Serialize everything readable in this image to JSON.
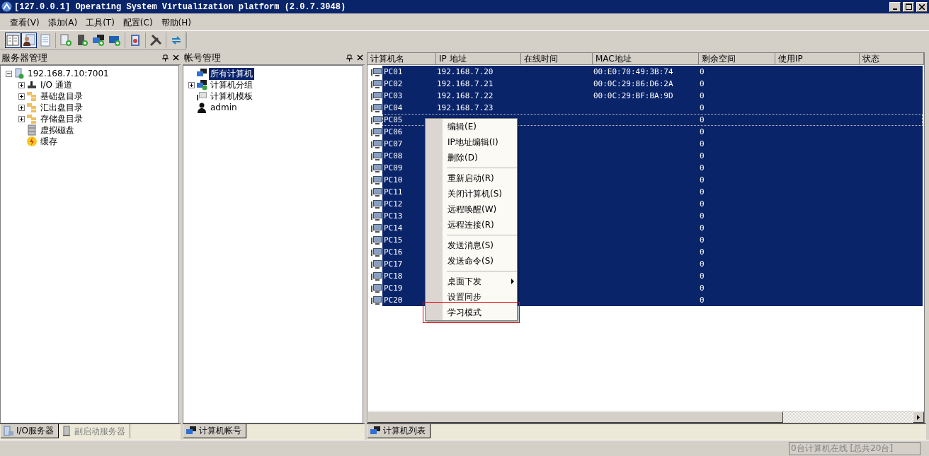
{
  "window": {
    "title": "[127.0.0.1] Operating System Virtualization platform (2.0.7.3048)"
  },
  "menu_bar": [
    "查看(V)",
    "添加(A)",
    "工具(T)",
    "配置(C)",
    "帮助(H)"
  ],
  "toolbar_groups": [
    [
      {
        "kind": "layout",
        "selected": true
      },
      {
        "kind": "user",
        "selected": true
      },
      {
        "kind": "document",
        "selected": false
      }
    ],
    [
      {
        "kind": "add-doc",
        "selected": false
      },
      {
        "kind": "add-server",
        "selected": false
      },
      {
        "kind": "add-network",
        "selected": false
      },
      {
        "kind": "add-monitor",
        "selected": false
      }
    ],
    [
      {
        "kind": "book",
        "selected": false
      }
    ],
    [
      {
        "kind": "tools",
        "selected": false
      }
    ],
    [
      {
        "kind": "sync",
        "selected": false
      }
    ]
  ],
  "server_panel": {
    "title": "服务器管理",
    "tree": [
      {
        "label": "192.168.7.10:7001",
        "kind": "server",
        "expanded": true,
        "children": [
          {
            "label": "I/O 通道",
            "kind": "channel",
            "expanded": false
          },
          {
            "label": "基础盘目录",
            "kind": "folders",
            "expanded": false
          },
          {
            "label": "汇出盘目录",
            "kind": "folders",
            "expanded": false
          },
          {
            "label": "存储盘目录",
            "kind": "folders",
            "expanded": false
          },
          {
            "label": "虚拟磁盘",
            "kind": "disk"
          },
          {
            "label": "缓存",
            "kind": "cache"
          }
        ]
      }
    ],
    "tabs": [
      {
        "label": "I/O服务器",
        "selected": true
      },
      {
        "label": "副启动服务器",
        "selected": false
      }
    ]
  },
  "account_panel": {
    "title": "帐号管理",
    "tree": [
      {
        "label": "所有计算机",
        "kind": "computers",
        "selected": true
      },
      {
        "label": "计算机分组",
        "kind": "group",
        "selected": false,
        "expanded": false
      },
      {
        "label": "计算机模板",
        "kind": "template",
        "selected": false
      },
      {
        "label": "admin",
        "kind": "user",
        "selected": false
      }
    ],
    "tabs": [
      {
        "label": "计算机帐号",
        "selected": true
      }
    ]
  },
  "computer_list": {
    "columns": [
      "计算机名",
      "IP 地址",
      "在线时间",
      "MAC地址",
      "剩余空间",
      "使用IP",
      "状态"
    ],
    "rows": [
      {
        "name": "PC01",
        "ip": "192.168.7.20",
        "mac": "00:E0:70:49:3B:74",
        "free": "0",
        "selected": true,
        "focused": false
      },
      {
        "name": "PC02",
        "ip": "192.168.7.21",
        "mac": "00:0C:29:86:D6:2A",
        "free": "0",
        "selected": true,
        "focused": false
      },
      {
        "name": "PC03",
        "ip": "192.168.7.22",
        "mac": "00:0C:29:BF:BA:9D",
        "free": "0",
        "selected": true,
        "focused": false
      },
      {
        "name": "PC04",
        "ip": "192.168.7.23",
        "free": "0",
        "selected": true,
        "focused": false
      },
      {
        "name": "PC05",
        "free": "0",
        "selected": true,
        "focused": true
      },
      {
        "name": "PC06",
        "free": "0",
        "selected": true,
        "focused": false
      },
      {
        "name": "PC07",
        "free": "0",
        "selected": true,
        "focused": false
      },
      {
        "name": "PC08",
        "free": "0",
        "selected": true,
        "focused": false
      },
      {
        "name": "PC09",
        "free": "0",
        "selected": true,
        "focused": false
      },
      {
        "name": "PC10",
        "free": "0",
        "selected": true,
        "focused": false
      },
      {
        "name": "PC11",
        "free": "0",
        "selected": true,
        "focused": false
      },
      {
        "name": "PC12",
        "free": "0",
        "selected": true,
        "focused": false
      },
      {
        "name": "PC13",
        "free": "0",
        "selected": true,
        "focused": false
      },
      {
        "name": "PC14",
        "free": "0",
        "selected": true,
        "focused": false
      },
      {
        "name": "PC15",
        "free": "0",
        "selected": true,
        "focused": false
      },
      {
        "name": "PC16",
        "free": "0",
        "selected": true,
        "focused": false
      },
      {
        "name": "PC17",
        "free": "0",
        "selected": true,
        "focused": false
      },
      {
        "name": "PC18",
        "free": "0",
        "selected": true,
        "focused": false
      },
      {
        "name": "PC19",
        "free": "0",
        "selected": true,
        "focused": false
      },
      {
        "name": "PC20",
        "free": "0",
        "selected": true,
        "focused": false
      }
    ],
    "tabs": [
      {
        "label": "计算机列表",
        "selected": true
      }
    ]
  },
  "context_menu": [
    {
      "kind": "item",
      "label": "编辑(E)"
    },
    {
      "kind": "item",
      "label": "IP地址编辑(I)"
    },
    {
      "kind": "item",
      "label": "删除(D)"
    },
    {
      "kind": "separator"
    },
    {
      "kind": "item",
      "label": "重新启动(R)"
    },
    {
      "kind": "item",
      "label": "关闭计算机(S)"
    },
    {
      "kind": "item",
      "label": "远程唤醒(W)"
    },
    {
      "kind": "item",
      "label": "远程连接(R)"
    },
    {
      "kind": "separator"
    },
    {
      "kind": "item",
      "label": "发送消息(S)"
    },
    {
      "kind": "item",
      "label": "发送命令(S)"
    },
    {
      "kind": "separator"
    },
    {
      "kind": "item",
      "label": "桌面下发",
      "has_submenu": true
    },
    {
      "kind": "item",
      "label": "设置同步"
    },
    {
      "kind": "item",
      "label": "学习模式",
      "highlighted": true
    }
  ],
  "status_bar": {
    "text": "0台计算机在线 [总共20台]"
  }
}
